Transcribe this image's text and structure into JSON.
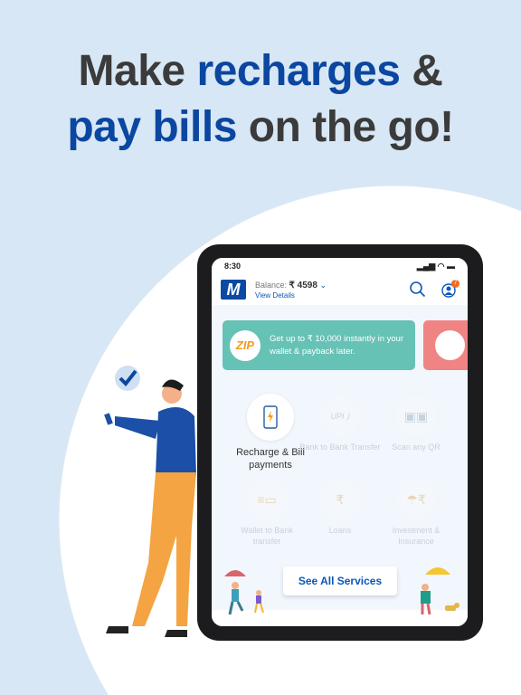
{
  "headline": {
    "line1_plain": "Make ",
    "line1_highlight": "recharges",
    "line1_end": " &",
    "line2_highlight": "pay bills",
    "line2_end": " on the go!"
  },
  "colors": {
    "accent": "#0b47a1",
    "banner": "#66c2b5",
    "banner2": "#f08484",
    "background": "#d8e7f5"
  },
  "status_bar": {
    "time": "8:30"
  },
  "header": {
    "logo": "M",
    "balance_label": "Balance: ",
    "balance_value": "₹ 4598",
    "view_details": "View Details",
    "notification_count": "7"
  },
  "banner": {
    "logo": "ZIP",
    "text": "Get up to ₹ 10,000 instantly in your wallet & payback later."
  },
  "services": [
    {
      "label": "Recharge & Bill payments",
      "icon": "phone-bolt-icon",
      "active": true
    },
    {
      "label": "Bank to Bank Transfer",
      "icon": "upi-icon"
    },
    {
      "label": "Scan any QR",
      "icon": "qr-icon"
    },
    {
      "label": "Wallet to Bank transfer",
      "icon": "wallet-transfer-icon"
    },
    {
      "label": "Loans",
      "icon": "loan-icon"
    },
    {
      "label": "Investment & Insurance",
      "icon": "investment-icon"
    }
  ],
  "see_all": "See All Services"
}
